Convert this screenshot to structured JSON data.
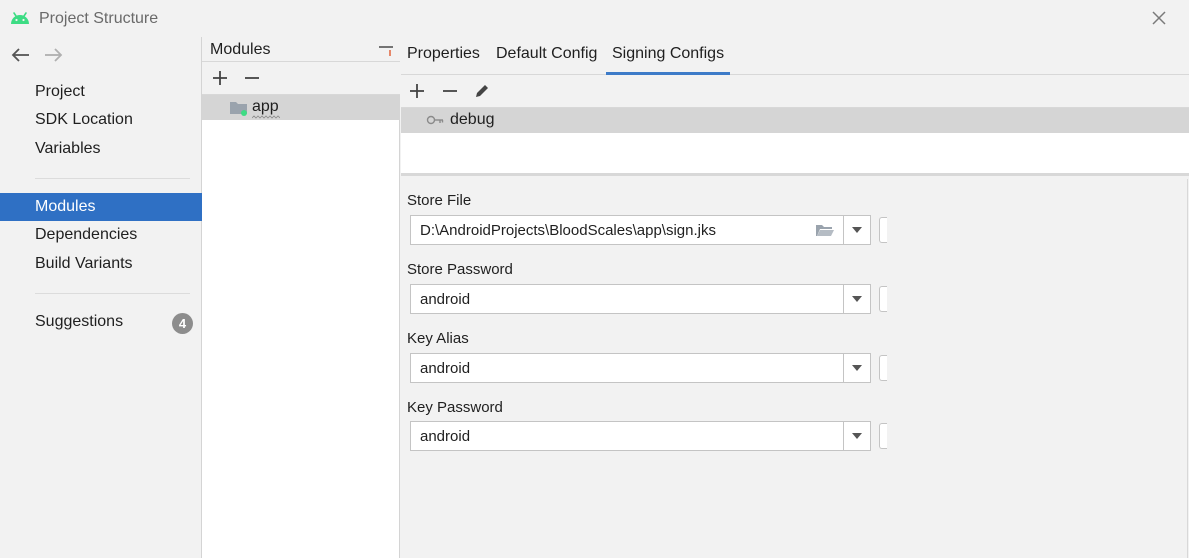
{
  "window": {
    "title": "Project Structure",
    "app_icon": "android-icon",
    "close_icon": "close-icon"
  },
  "nav": {
    "back_icon": "back-arrow-icon",
    "forward_icon": "forward-arrow-icon",
    "items": [
      {
        "label": "Project"
      },
      {
        "label": "SDK Location"
      },
      {
        "label": "Variables"
      },
      {
        "label": "Modules"
      },
      {
        "label": "Dependencies"
      },
      {
        "label": "Build Variants"
      },
      {
        "label": "Suggestions",
        "badge": "4"
      }
    ],
    "selected": "Modules"
  },
  "modules_panel": {
    "header": "Modules",
    "items": [
      {
        "name": "app"
      }
    ]
  },
  "tabs": [
    {
      "label": "Properties"
    },
    {
      "label": "Default Config"
    },
    {
      "label": "Signing Configs"
    }
  ],
  "active_tab": "Signing Configs",
  "signing_configs": [
    {
      "name": "debug"
    }
  ],
  "form": {
    "store_file": {
      "label": "Store File",
      "value": "D:\\AndroidProjects\\BloodScales\\app\\sign.jks"
    },
    "store_password": {
      "label": "Store Password",
      "value": "android"
    },
    "key_alias": {
      "label": "Key Alias",
      "value": "android"
    },
    "key_password": {
      "label": "Key Password",
      "value": "android"
    }
  },
  "colors": {
    "selection": "#2f70c4",
    "tab_underline": "#3d7bc8",
    "row_highlight": "#d5d5d5",
    "badge": "#8d8d8d",
    "android_green": "#3ddc84"
  }
}
